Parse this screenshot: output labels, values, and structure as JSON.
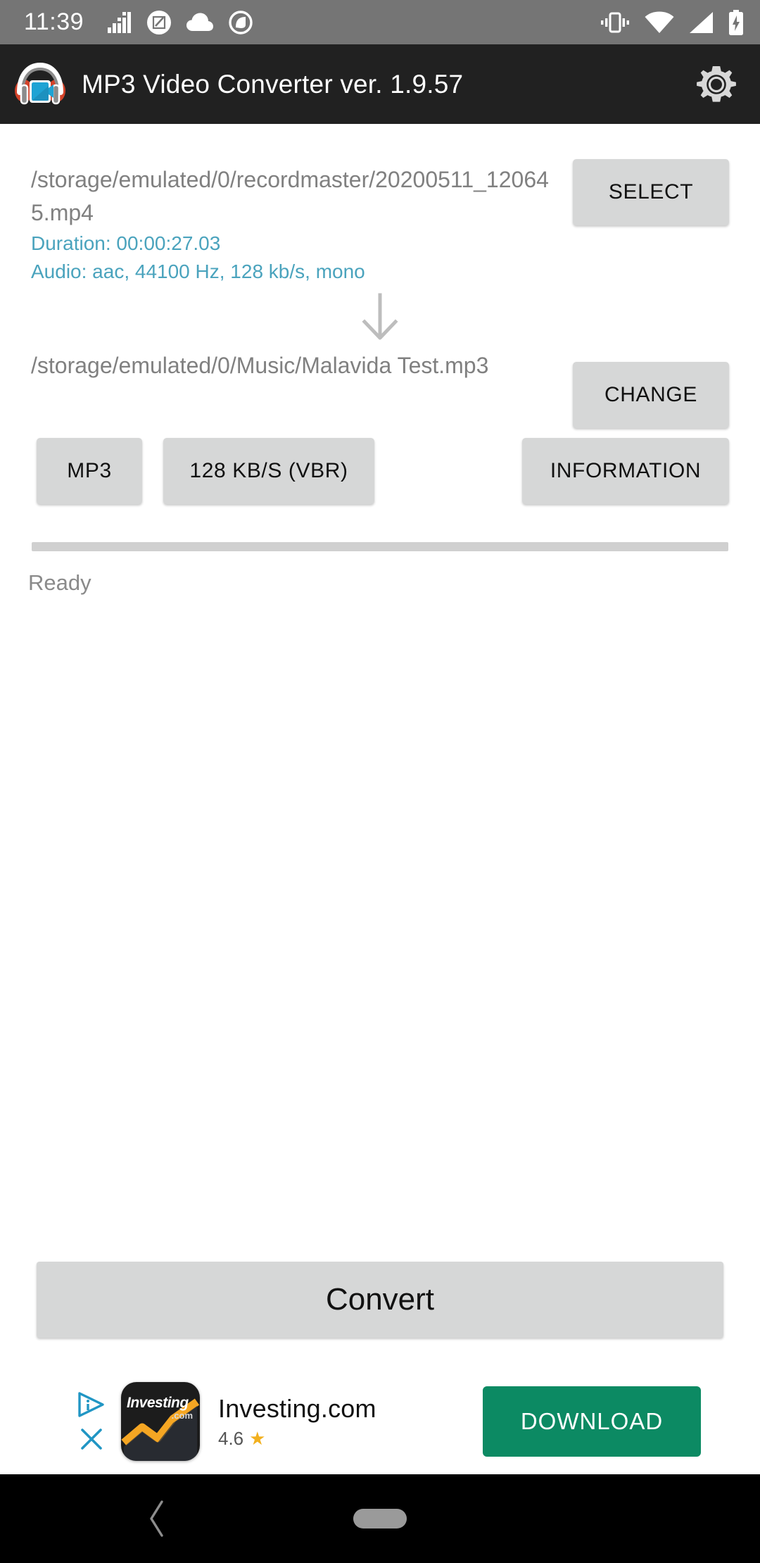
{
  "status_bar": {
    "time": "11:39",
    "left_icons": [
      "equalizer-icon",
      "crop-edit-icon",
      "cloud-icon",
      "circle-slash-icon"
    ],
    "right_icons": [
      "vibrate-icon",
      "wifi-icon",
      "cellular-signal-icon",
      "battery-charging-icon"
    ],
    "background": "#757575"
  },
  "app_bar": {
    "title": "MP3 Video Converter ver. 1.9.57",
    "app_icon": "headphones-video-icon",
    "settings_icon": "gear-icon",
    "background": "#212121"
  },
  "source": {
    "path": "/storage/emulated/0/recordmaster/20200511_120645.mp4",
    "duration": "Duration: 00:00:27.03",
    "audio": "Audio: aac, 44100 Hz, 128 kb/s, mono",
    "meta_color": "#4aa3bd",
    "select_label": "SELECT"
  },
  "arrow_icon": "arrow-down-icon",
  "destination": {
    "path": "/storage/emulated/0/Music/Malavida Test.mp3",
    "change_label": "CHANGE"
  },
  "options": {
    "format_label": "MP3",
    "bitrate_label": "128 KB/S (VBR)",
    "information_label": "INFORMATION"
  },
  "progress": {
    "percent": 0,
    "status_text": "Ready",
    "track_color": "#d0d0d0"
  },
  "convert": {
    "label": "Convert"
  },
  "ad": {
    "adchoices_icon": "adchoices-icon",
    "close_icon": "close-icon",
    "app_icon_name": "investing-app-icon",
    "app_icon_text": "Investing",
    "app_icon_subtext": ".com",
    "title": "Investing.com",
    "rating": "4.6",
    "star_icon": "star-icon",
    "button_label": "DOWNLOAD",
    "button_color": "#0c8a63"
  },
  "nav_bar": {
    "back_icon": "back-chevron-icon",
    "home_icon": "home-pill-icon",
    "background": "#000000"
  }
}
